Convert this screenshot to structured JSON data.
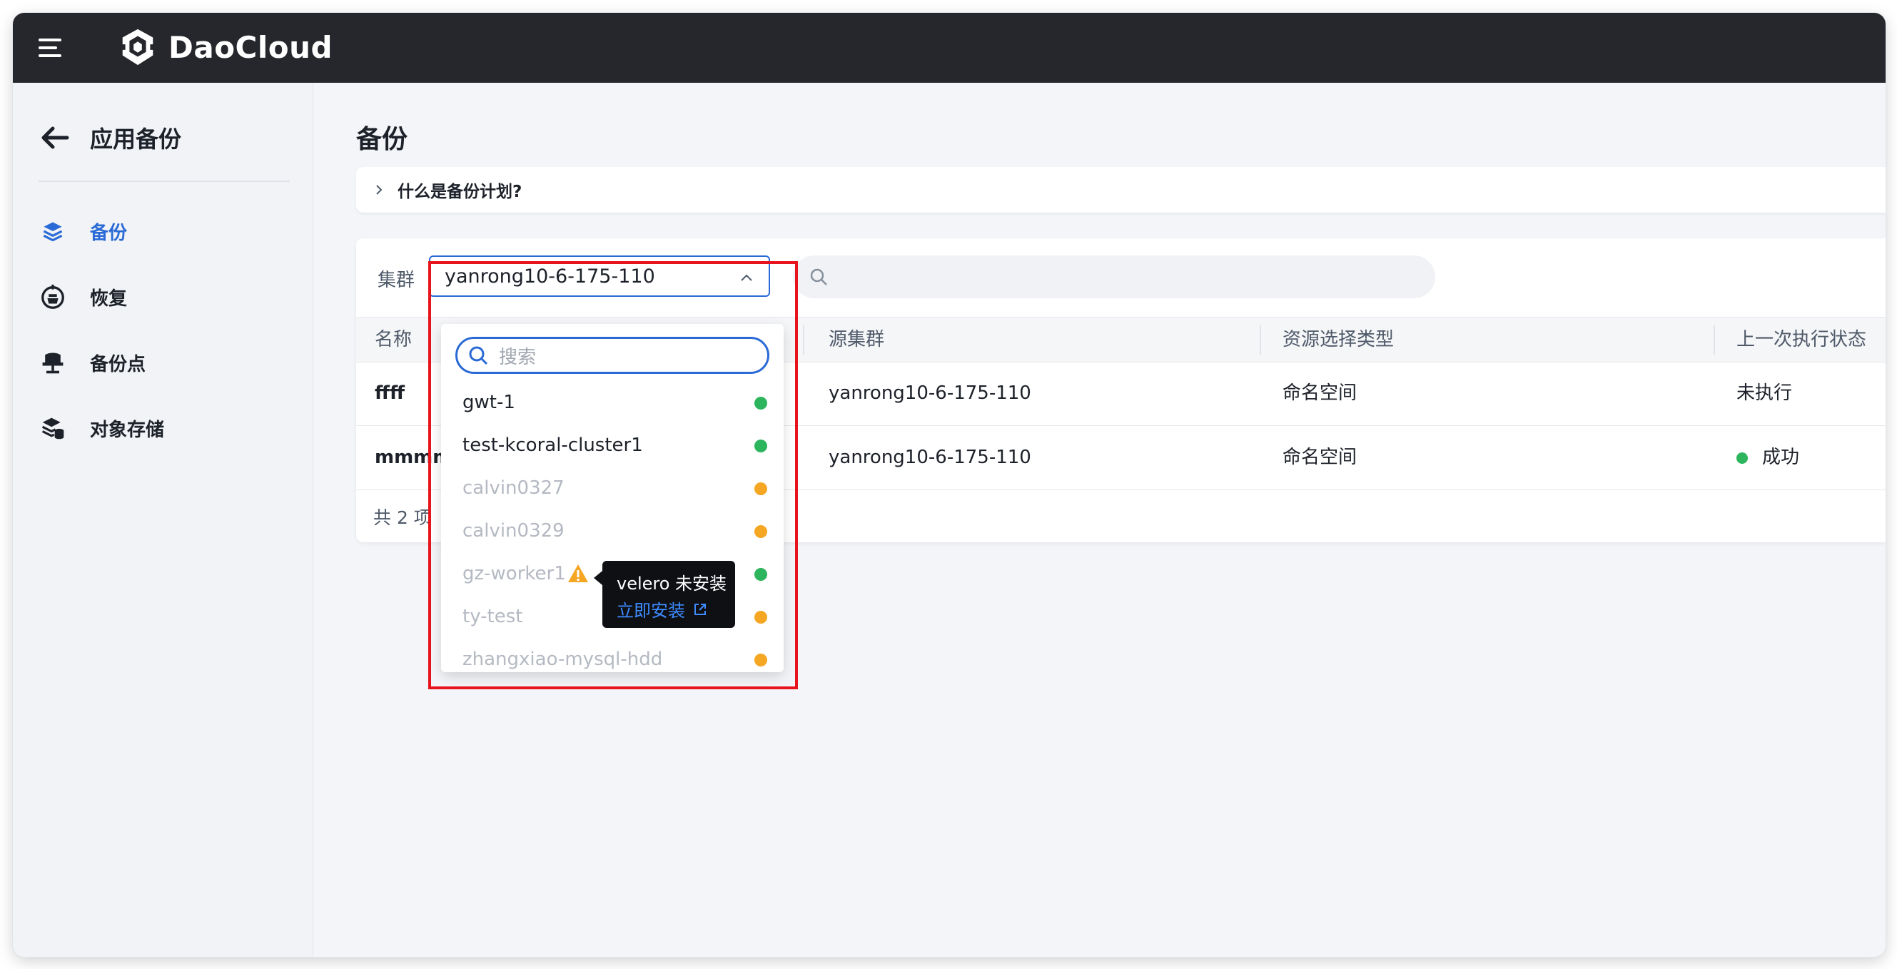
{
  "app": {
    "brand": "DaoCloud"
  },
  "sidebar": {
    "title": "应用备份",
    "items": [
      {
        "label": "备份",
        "icon": "layers-icon",
        "active": true
      },
      {
        "label": "恢复",
        "icon": "restore-icon",
        "active": false
      },
      {
        "label": "备份点",
        "icon": "backup-point-icon",
        "active": false
      },
      {
        "label": "对象存储",
        "icon": "object-storage-icon",
        "active": false
      }
    ]
  },
  "main": {
    "title": "备份",
    "info_bar": "什么是备份计划?",
    "filter": {
      "label": "集群",
      "selected_cluster": "yanrong10-6-175-110"
    },
    "search": {
      "placeholder": ""
    },
    "table": {
      "columns": [
        "名称",
        "源集群",
        "资源选择类型",
        "上一次执行状态"
      ],
      "rows": [
        {
          "name": "ffff",
          "source_cluster": "yanrong10-6-175-110",
          "resource_type": "命名空间",
          "last_status": "未执行",
          "status_color": ""
        },
        {
          "name": "mmmm",
          "source_cluster": "yanrong10-6-175-110",
          "resource_type": "命名空间",
          "last_status": "成功",
          "status_color": "#2db55d"
        }
      ],
      "total": "共 2 项"
    }
  },
  "dropdown": {
    "search_placeholder": "搜索",
    "options": [
      {
        "label": "gwt-1",
        "status": "green",
        "disabled": false
      },
      {
        "label": "test-kcoral-cluster1",
        "status": "green",
        "disabled": false
      },
      {
        "label": "calvin0327",
        "status": "orange",
        "disabled": true
      },
      {
        "label": "calvin0329",
        "status": "orange",
        "disabled": true
      },
      {
        "label": "gz-worker1",
        "status": "green",
        "disabled": true,
        "warning": true
      },
      {
        "label": "ty-test",
        "status": "orange",
        "disabled": true
      },
      {
        "label": "zhangxiao-mysql-hdd",
        "status": "orange",
        "disabled": true
      }
    ]
  },
  "tooltip": {
    "text": "velero 未安装",
    "link": "立即安装"
  },
  "colors": {
    "accent": "#2a6ad6",
    "success": "#2db55d",
    "warning": "#f5a623",
    "highlight_frame": "#e8141d"
  }
}
